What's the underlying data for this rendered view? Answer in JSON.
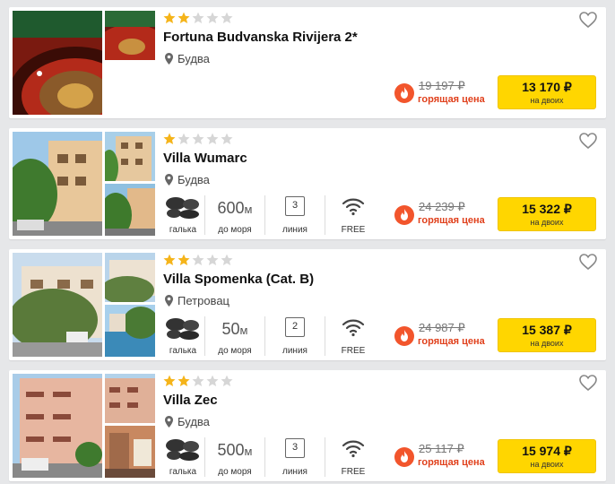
{
  "colors": {
    "accent_yellow": "#ffd600",
    "hot_red": "#e0401c",
    "star_gold": "#f5b41a",
    "star_gray": "#d6d6d6"
  },
  "features": {
    "beach_label": "галька",
    "distance_label": "до моря",
    "line_label": "линия",
    "wifi_label": "FREE"
  },
  "hotels": [
    {
      "stars": 2,
      "max_stars": 5,
      "name": "Fortuna Budvanska Rivijera 2*",
      "location": "Будва",
      "show_features": false,
      "old_price": "19 197 ₽",
      "hot_label": "горящая цена",
      "price": "13 170 ₽",
      "price_note": "на двоих"
    },
    {
      "stars": 1,
      "max_stars": 5,
      "name": "Villa Wumarc",
      "location": "Будва",
      "show_features": true,
      "distance_value": "600",
      "distance_unit": "м",
      "line_number": "3",
      "old_price": "24 239 ₽",
      "hot_label": "горящая цена",
      "price": "15 322 ₽",
      "price_note": "на двоих"
    },
    {
      "stars": 2,
      "max_stars": 5,
      "name": "Villa Spomenka (Cat. B)",
      "location": "Петровац",
      "show_features": true,
      "distance_value": "50",
      "distance_unit": "м",
      "line_number": "2",
      "old_price": "24 987 ₽",
      "hot_label": "горящая цена",
      "price": "15 387 ₽",
      "price_note": "на двоих"
    },
    {
      "stars": 2,
      "max_stars": 5,
      "name": "Villa Zec",
      "location": "Будва",
      "show_features": true,
      "distance_value": "500",
      "distance_unit": "м",
      "line_number": "3",
      "old_price": "25 117 ₽",
      "hot_label": "горящая цена",
      "price": "15 974 ₽",
      "price_note": "на двоих"
    }
  ]
}
